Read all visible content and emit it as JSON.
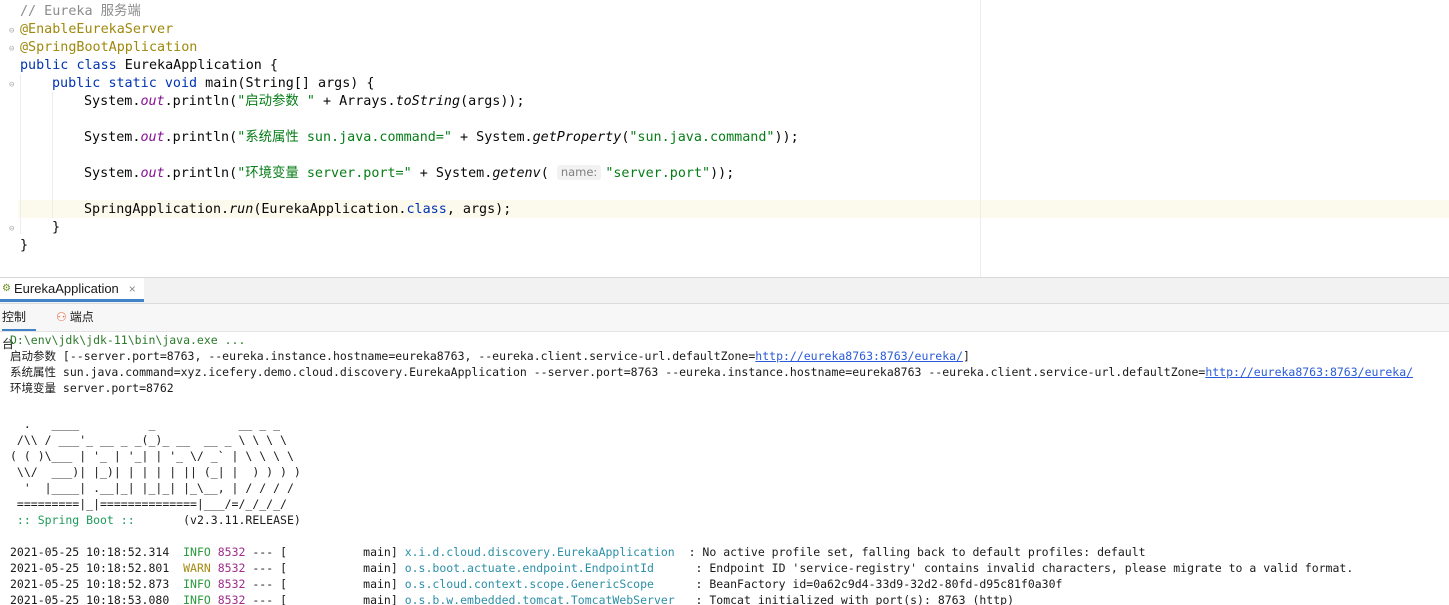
{
  "editor": {
    "comment": "// Eureka 服务端",
    "annotation1": "@EnableEurekaServer",
    "annotation2": "@SpringBootApplication",
    "class_kw1": "public",
    "class_kw2": "class",
    "class_decl": " EurekaApplication {",
    "main_kw1": "public",
    "main_kw2": "static",
    "main_kw3": "void",
    "main_decl": " main(String[] args) {",
    "sys": "System.",
    "out": "out",
    "println": ".println(",
    "l1_str": "\"启动参数 \"",
    "l1_rest": " + Arrays.",
    "l1_meth": "toString",
    "l1_end": "(args));",
    "l2_str": "\"系统属性 sun.java.command=\"",
    "l2_rest": " + System.",
    "l2_meth": "getProperty",
    "l2_arg": "(",
    "l2_arg_str": "\"sun.java.command\"",
    "l2_end": "));",
    "l3_str": "\"环境变量 server.port=\"",
    "l3_rest": " + System.",
    "l3_meth": "getenv",
    "l3_open": "( ",
    "l3_hint": "name:",
    "l3_arg_str": "\"server.port\"",
    "l3_end": "));",
    "l4_pre": "SpringApplication.",
    "l4_meth": "run",
    "l4_mid": "(EurekaApplication.",
    "l4_kw": "class",
    "l4_end": ", args);",
    "close_inner": "}",
    "close_outer": "}"
  },
  "run_panel": {
    "tab_label": "EurekaApplication",
    "close_glyph": "×",
    "console_tab": "控制台",
    "breakpoints_tab": "端点"
  },
  "console": {
    "cmd": "D:\\env\\jdk\\jdk-11\\bin\\java.exe ...",
    "line1_text": "启动参数 [--server.port=8763, --eureka.instance.hostname=eureka8763, --eureka.client.service-url.defaultZone=",
    "line1_link": "http://eureka8763:8763/eureka/",
    "line1_end": "]",
    "line2_text": "系统属性 sun.java.command=xyz.icefery.demo.cloud.discovery.EurekaApplication --server.port=8763 --eureka.instance.hostname=eureka8763 --eureka.client.service-url.defaultZone=",
    "line2_link": "http://eureka8763:8763/eureka/",
    "line3_text": "环境变量 server.port=8762",
    "banner": [
      "  .   ____          _            __ _ _",
      " /\\\\ / ___'_ __ _ _(_)_ __  __ _ \\ \\ \\ \\",
      "( ( )\\___ | '_ | '_| | '_ \\/ _` | \\ \\ \\ \\",
      " \\\\/  ___)| |_)| | | | | || (_| |  ) ) ) )",
      "  '  |____| .__|_| |_|_| |_\\__, | / / / /",
      " =========|_|==============|___/=/_/_/_/"
    ],
    "spring_boot_label": " :: Spring Boot :: ",
    "spring_boot_version": "      (v2.3.11.RELEASE)",
    "logs": [
      {
        "time": "2021-05-25 10:18:52.314",
        "level": "INFO",
        "pid": "8532",
        "thread": " --- [           main] ",
        "logger": "x.i.d.cloud.discovery.EurekaApplication ",
        "message": " : No active profile set, falling back to default profiles: default"
      },
      {
        "time": "2021-05-25 10:18:52.801",
        "level": "WARN",
        "pid": "8532",
        "thread": " --- [           main] ",
        "logger": "o.s.boot.actuate.endpoint.EndpointId     ",
        "message": " : Endpoint ID 'service-registry' contains invalid characters, please migrate to a valid format."
      },
      {
        "time": "2021-05-25 10:18:52.873",
        "level": "INFO",
        "pid": "8532",
        "thread": " --- [           main] ",
        "logger": "o.s.cloud.context.scope.GenericScope     ",
        "message": " : BeanFactory id=0a62c9d4-33d9-32d2-80fd-d95c81f0a30f"
      },
      {
        "time": "2021-05-25 10:18:53.080",
        "level": "INFO",
        "pid": "8532",
        "thread": " --- [           main] ",
        "logger": "o.s.b.w.embedded.tomcat.TomcatWebServer  ",
        "message": " : Tomcat initialized with port(s): 8763 (http)"
      }
    ]
  }
}
